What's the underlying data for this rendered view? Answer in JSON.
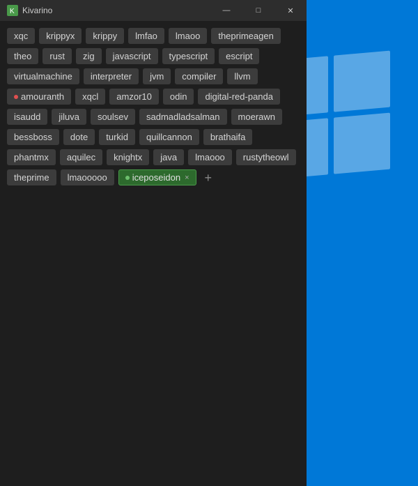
{
  "desktop": {
    "background": "#0078d7"
  },
  "window": {
    "title": "Kivarino",
    "icon": "K"
  },
  "titlebar": {
    "minimize_label": "—",
    "maximize_label": "□",
    "close_label": "✕"
  },
  "tags": [
    {
      "id": "xqc",
      "label": "xqc",
      "state": "normal"
    },
    {
      "id": "krippyx",
      "label": "krippyx",
      "state": "normal"
    },
    {
      "id": "krippy",
      "label": "krippy",
      "state": "normal"
    },
    {
      "id": "lmfao",
      "label": "lmfao",
      "state": "normal"
    },
    {
      "id": "lmaoo",
      "label": "lmaoo",
      "state": "normal"
    },
    {
      "id": "theprimeagen",
      "label": "theprimeagen",
      "state": "normal"
    },
    {
      "id": "theo",
      "label": "theo",
      "state": "normal"
    },
    {
      "id": "rust",
      "label": "rust",
      "state": "normal"
    },
    {
      "id": "zig",
      "label": "zig",
      "state": "normal"
    },
    {
      "id": "javascript",
      "label": "javascript",
      "state": "normal"
    },
    {
      "id": "typescript",
      "label": "typescript",
      "state": "normal"
    },
    {
      "id": "escript",
      "label": "escript",
      "state": "normal"
    },
    {
      "id": "virtualmachine",
      "label": "virtualmachine",
      "state": "normal"
    },
    {
      "id": "interpreter",
      "label": "interpreter",
      "state": "normal"
    },
    {
      "id": "jvm",
      "label": "jvm",
      "state": "normal"
    },
    {
      "id": "compiler",
      "label": "compiler",
      "state": "normal"
    },
    {
      "id": "llvm",
      "label": "llvm",
      "state": "normal"
    },
    {
      "id": "amouranth",
      "label": "amouranth",
      "state": "dot-red"
    },
    {
      "id": "xqcl",
      "label": "xqcl",
      "state": "normal"
    },
    {
      "id": "amzor10",
      "label": "amzor10",
      "state": "normal"
    },
    {
      "id": "odin",
      "label": "odin",
      "state": "normal"
    },
    {
      "id": "digital-red-panda",
      "label": "digital-red-panda",
      "state": "normal"
    },
    {
      "id": "isaudd",
      "label": "isaudd",
      "state": "normal"
    },
    {
      "id": "jiluva",
      "label": "jiluva",
      "state": "normal"
    },
    {
      "id": "soulsev",
      "label": "soulsev",
      "state": "normal"
    },
    {
      "id": "sadmadladsalman",
      "label": "sadmadladsalman",
      "state": "normal"
    },
    {
      "id": "moerawn",
      "label": "moerawn",
      "state": "normal"
    },
    {
      "id": "bessboss",
      "label": "bessboss",
      "state": "normal"
    },
    {
      "id": "dote",
      "label": "dote",
      "state": "normal"
    },
    {
      "id": "turkid",
      "label": "turkid",
      "state": "normal"
    },
    {
      "id": "quillcannon",
      "label": "quillcannon",
      "state": "normal"
    },
    {
      "id": "brathaifa",
      "label": "brathaifa",
      "state": "normal"
    },
    {
      "id": "phantmx",
      "label": "phantmx",
      "state": "normal"
    },
    {
      "id": "aquilec",
      "label": "aquilec",
      "state": "normal"
    },
    {
      "id": "knightx",
      "label": "knightx",
      "state": "normal"
    },
    {
      "id": "java",
      "label": "java",
      "state": "normal"
    },
    {
      "id": "lmaooo",
      "label": "lmaooo",
      "state": "normal"
    },
    {
      "id": "rustytheowl",
      "label": "rustytheowl",
      "state": "normal"
    },
    {
      "id": "theprime",
      "label": "theprime",
      "state": "normal"
    },
    {
      "id": "lmaooooo",
      "label": "lmaooooo",
      "state": "normal"
    },
    {
      "id": "iceposeidon",
      "label": "iceposeidon",
      "state": "active"
    }
  ],
  "add_button": "+"
}
